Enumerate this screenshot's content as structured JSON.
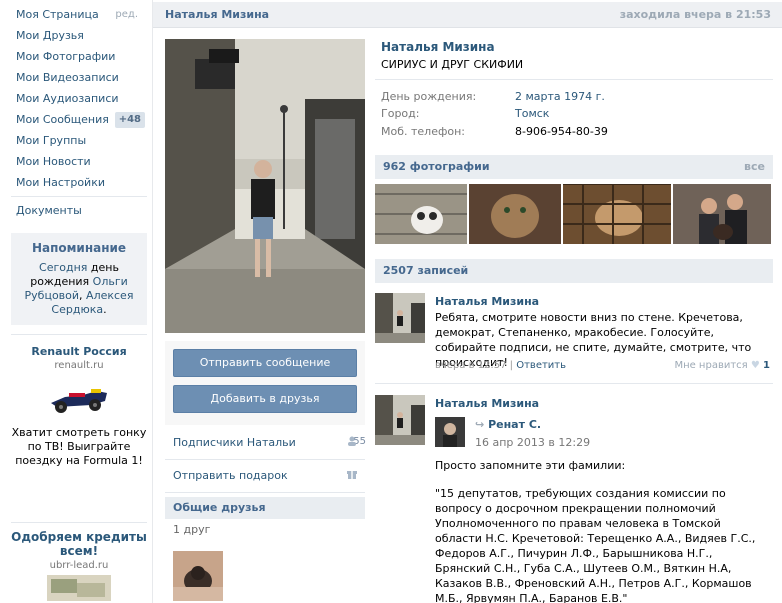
{
  "nav": {
    "items": [
      {
        "label": "Моя Страница",
        "extra": "ред."
      },
      {
        "label": "Мои Друзья"
      },
      {
        "label": "Мои Фотографии"
      },
      {
        "label": "Мои Видеозаписи"
      },
      {
        "label": "Мои Аудиозаписи"
      },
      {
        "label": "Мои Сообщения",
        "badge": "+48"
      },
      {
        "label": "Мои Группы"
      },
      {
        "label": "Мои Новости"
      },
      {
        "label": "Мои Настройки"
      }
    ],
    "documents": "Документы"
  },
  "reminder": {
    "title": "Напоминание",
    "today": "Сегодня",
    "day": "день",
    "birthday": "рождения",
    "friend1": "Ольги Рубцовой",
    "comma": ", ",
    "friend2": "Алексея Сердюка",
    "dot": "."
  },
  "ads": [
    {
      "title": "Renault Россия",
      "domain": "renault.ru",
      "text": "Хватит смотреть гонку по ТВ! Выиграйте поездку на Formula 1!"
    },
    {
      "title": "Одобряем кредиты всем!",
      "domain": "ubrr-lead.ru"
    }
  ],
  "header": {
    "name": "Наталья Мизина",
    "status": "заходила вчера в 21:53"
  },
  "profile": {
    "name": "Наталья Мизина",
    "status": "СИРИУС И ДРУГ СКИФИИ",
    "fields": [
      {
        "label": "День рождения:",
        "value": "2 марта 1974 г.",
        "link": true
      },
      {
        "label": "Город:",
        "value": "Томск",
        "link": true
      },
      {
        "label": "Моб. телефон:",
        "value": "8-906-954-80-39",
        "link": false
      }
    ]
  },
  "buttons": {
    "message": "Отправить сообщение",
    "add_friend": "Добавить в друзья"
  },
  "side": {
    "subscribers": "Подписчики Натальи",
    "subscribers_count": "55",
    "gift": "Отправить подарок",
    "common_friends": "Общие друзья",
    "friends_count": "1 друг"
  },
  "photos": {
    "title": "962 фотографии",
    "all": "все"
  },
  "wall": {
    "title": "2507 записей",
    "posts": [
      {
        "author": "Наталья Мизина",
        "text": "Ребята, смотрите новости вниз по стене. Кречетова, демократ, Степаненко, мракобесие. Голосуйте, собирайте подписи, не спите, думайте, смотрите, что происходит!",
        "time": "вчера в 12:57",
        "sep": " | ",
        "reply": "Ответить",
        "like_label": "Мне нравится",
        "likes": "1"
      },
      {
        "author": "Наталья Мизина",
        "repost_name": "Ренат С.",
        "repost_date": "16 апр 2013 в 12:29",
        "intro": "Просто запомните эти фамилии:",
        "body": "\"15 депутатов, требующих создания комиссии по вопросу о досрочном прекращении полномочий Уполномоченного по правам человека в Томской области Н.С. Кречетовой: Терещенко А.А., Видяев Г.С., Федоров А.Г., Пичурин Л.Ф., Барышникова Н.Г., Брянский С.Н., Губа С.А., Шутеев О.М., Вяткин Н.А, Казаков В.В., Френовский А.Н., Петров А.Г., Кормашов М.Б., Ярвумян П.А., Баранов Е.В.\""
      }
    ]
  },
  "colors": {
    "link": "#2b587a",
    "header_bg": "#eef0f3",
    "button": "#6d8fb3",
    "section_bg": "#e9edf1"
  }
}
